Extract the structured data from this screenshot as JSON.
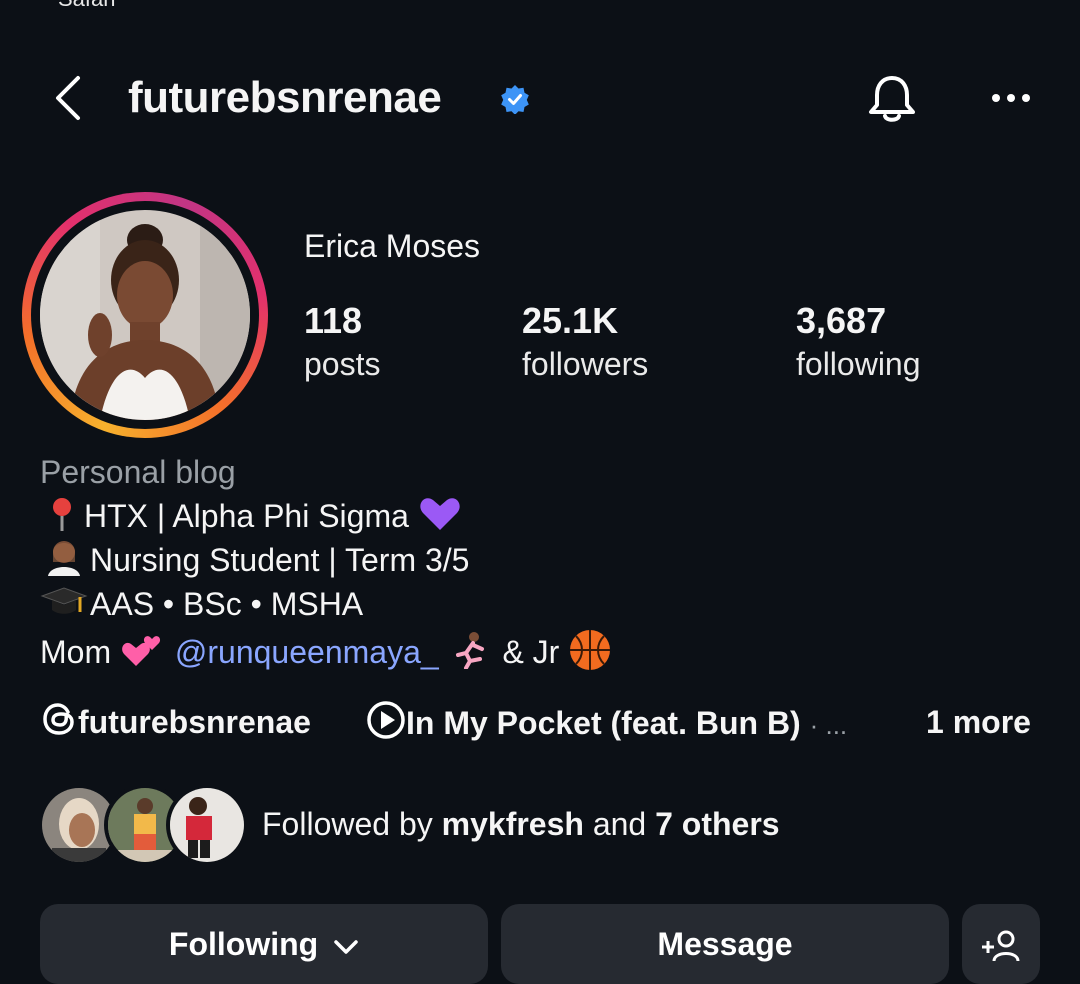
{
  "status_bar": {
    "carrier_partial": "Safari"
  },
  "header": {
    "username": "futurebsnrenae",
    "verified_icon": "verified-badge-icon",
    "bell_icon": "bell-icon",
    "more_icon": "ellipsis-icon",
    "back_icon": "chevron-left-icon"
  },
  "profile": {
    "full_name": "Erica Moses",
    "stats": [
      {
        "value": "118",
        "label": "posts"
      },
      {
        "value": "25.1K",
        "label": "followers"
      },
      {
        "value": "3,687",
        "label": "following"
      }
    ],
    "category": "Personal blog",
    "bio": {
      "line1_text": "HTX | Alpha Phi Sigma",
      "line2_text": "Nursing Student | Term 3/5",
      "line3_text": "AAS • BSc • MSHA",
      "line4_prefix": "Mom",
      "line4_mention": "@runqueenmaya_",
      "line4_suffix": "& Jr"
    },
    "links": {
      "threads_handle": "futurebsnrenae",
      "music": "In My Pocket (feat. Bun B)",
      "separator": "· ...",
      "more": "1 more"
    },
    "followed_by": {
      "prefix": "Followed by",
      "name": "mykfresh",
      "middle": "and",
      "others": "7 others"
    }
  },
  "actions": {
    "following": "Following",
    "message": "Message"
  },
  "colors": {
    "background": "#0c1016",
    "button": "#262a31",
    "mention": "#8aa6ff",
    "verified": "#3d94f6"
  }
}
